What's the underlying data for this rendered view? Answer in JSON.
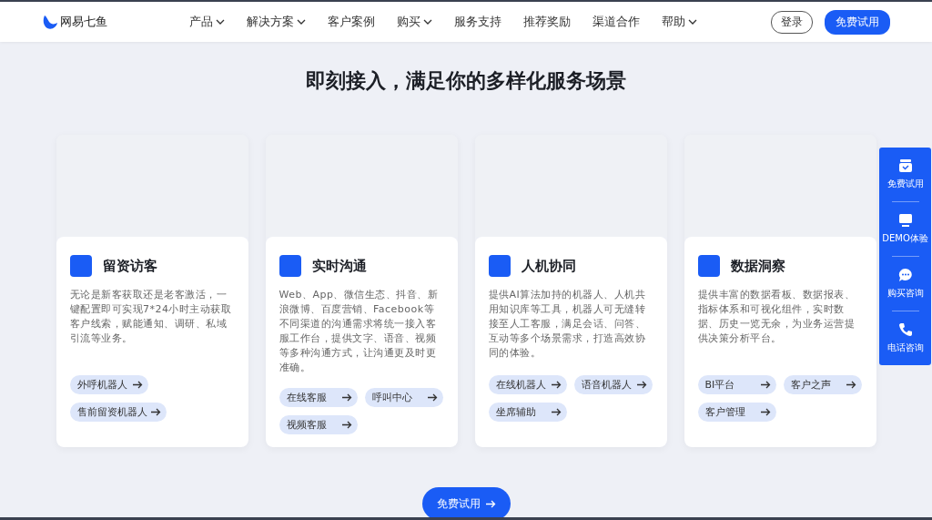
{
  "header": {
    "logo": "网易七鱼",
    "nav": [
      {
        "label": "产品",
        "dropdown": true
      },
      {
        "label": "解决方案",
        "dropdown": true
      },
      {
        "label": "客户案例",
        "dropdown": false
      },
      {
        "label": "购买",
        "dropdown": true
      },
      {
        "label": "服务支持",
        "dropdown": false
      },
      {
        "label": "推荐奖励",
        "dropdown": false
      },
      {
        "label": "渠道合作",
        "dropdown": false
      },
      {
        "label": "帮助",
        "dropdown": true
      }
    ],
    "login": "登录",
    "trial": "免费试用"
  },
  "section": {
    "title": "即刻接入，满足你的多样化服务场景",
    "cards": [
      {
        "title": "留资访客",
        "text": "无论是新客获取还是老客激活，一键配置即可实现7*24小时主动获取客户线索，赋能通知、调研、私域引流等业务。",
        "links": [
          "外呼机器人",
          "售前留资机器人"
        ]
      },
      {
        "title": "实时沟通",
        "text": "Web、App、微信生态、抖音、新浪微博、百度营销、Facebook等不同渠道的沟通需求将统一接入客服工作台，提供文字、语音、视频等多种沟通方式，让沟通更及时更准确。",
        "links": [
          "在线客服",
          "呼叫中心",
          "视频客服"
        ]
      },
      {
        "title": "人机协同",
        "text": "提供AI算法加持的机器人、人机共用知识库等工具，机器人可无缝转接至人工客服，满足会话、问答、互动等多个场景需求，打造高效协同的体验。",
        "links": [
          "在线机器人",
          "语音机器人",
          "坐席辅助"
        ]
      },
      {
        "title": "数据洞察",
        "text": "提供丰富的数据看板、数据报表、指标体系和可视化组件，实时数据、历史一览无余，为业务运营提供决策分析平台。",
        "links": [
          "BI平台",
          "客户之声",
          "客户管理"
        ]
      }
    ],
    "cta": "免费试用"
  },
  "float_bar": [
    {
      "kind": "trial",
      "label": "免费试用"
    },
    {
      "kind": "demo",
      "label": "DEMO体验"
    },
    {
      "kind": "chat",
      "label": "购买咨询"
    },
    {
      "kind": "phone",
      "label": "电话咨询"
    }
  ]
}
